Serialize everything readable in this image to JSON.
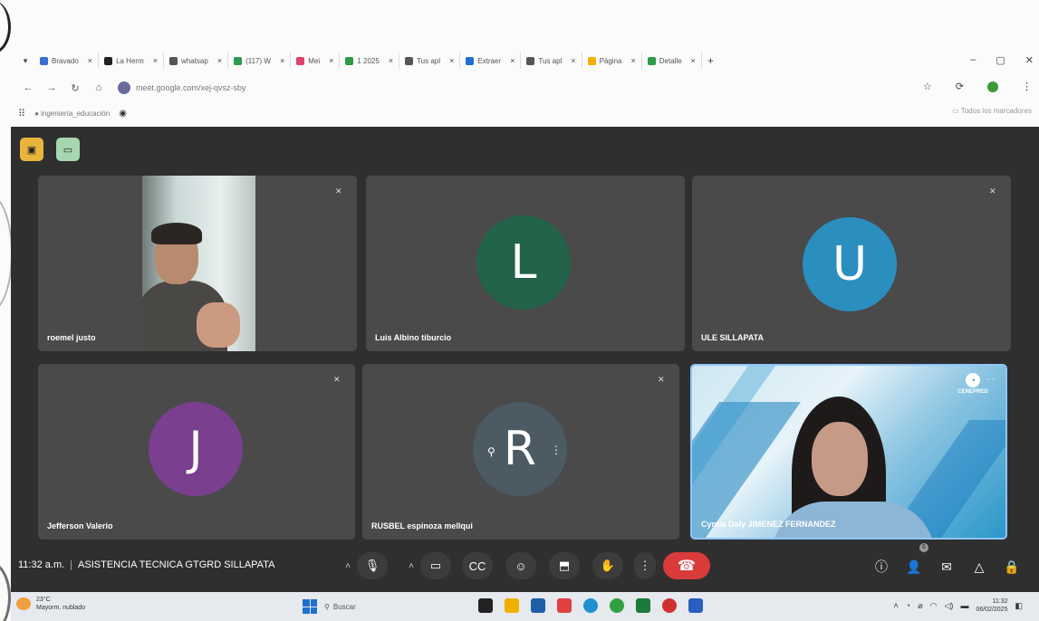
{
  "browser": {
    "tabs": [
      {
        "label": "Bravado",
        "color": "#3a6fd0"
      },
      {
        "label": "La Herm",
        "color": "#222222"
      },
      {
        "label": "whatsap",
        "color": "#555555"
      },
      {
        "label": "(117) W",
        "color": "#2c9a4a"
      },
      {
        "label": "Mei",
        "color": "#e0406a"
      },
      {
        "label": "1 2025",
        "color": "#2c9a4a"
      },
      {
        "label": "Tus apl",
        "color": "#555555"
      },
      {
        "label": "Extraer",
        "color": "#1e6fd0"
      },
      {
        "label": "Tus apl",
        "color": "#555555"
      },
      {
        "label": "Página",
        "color": "#f0b000"
      },
      {
        "label": "Detalle",
        "color": "#2c9a4a"
      }
    ],
    "url": "meet.google.com/xej-qvsz-sby",
    "bookmark": "ingeniería_educación",
    "all_bookmarks": "Todos los marcadores"
  },
  "meet": {
    "participants": [
      {
        "name": "roemel justo",
        "type": "video"
      },
      {
        "name": "Luis Albino tiburcio",
        "type": "avatar",
        "initial": "L",
        "color": "#22634a"
      },
      {
        "name": "ULE SILLAPATA",
        "type": "avatar",
        "initial": "U",
        "color": "#2a8fbf"
      },
      {
        "name": "Jefferson Valerio",
        "type": "avatar",
        "initial": "J",
        "color": "#7a3f8e"
      },
      {
        "name": "RUSBEL espinoza mellqui",
        "type": "avatar",
        "initial": "R",
        "color": "#4b5a63"
      },
      {
        "name": "Cyntia Daly JIMENEZ FERNANDEZ",
        "type": "video"
      }
    ],
    "time": "11:32 a.m.",
    "meeting_title": "ASISTENCIA TECNICA GTGRD SILLAPATA",
    "participant_badge": "6",
    "video_logo_text": "CENEPRED"
  },
  "taskbar": {
    "weather_temp": "23°C",
    "weather_desc": "Mayorm. nublado",
    "search_label": "Buscar",
    "clock_time": "11:32",
    "clock_date": "06/02/2025"
  },
  "icons": {
    "mute": "mic-off-icon",
    "end_call": "end-call-icon"
  }
}
